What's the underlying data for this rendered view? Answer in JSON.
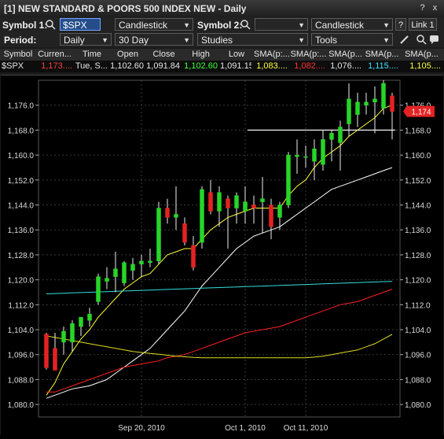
{
  "window": {
    "title": "[1] NEW STANDARD & POORS 500 INDEX NEW - Daily",
    "btn_help": "?",
    "btn_close": "x"
  },
  "toolbar1": {
    "symbol1_label": "Symbol 1:",
    "symbol1_value": "$SPX",
    "chart_type1": "Candlestick",
    "symbol2_label": "Symbol 2:",
    "symbol2_value": "",
    "chart_type2": "Candlestick",
    "help_label": "?",
    "link_label": "Link 1"
  },
  "toolbar2": {
    "period_label": "Period:",
    "period_value": "Daily",
    "range_value": "30 Day",
    "studies_label": "Studies",
    "tools_label": "Tools"
  },
  "quote_table": {
    "headers": [
      "Symbol",
      "Curren...",
      "Time",
      "Open",
      "Close",
      "High",
      "Low",
      "SMA(p:...",
      "SMA(p:...",
      "SMA(p...",
      "SMA(p...",
      "SMA(p..."
    ],
    "row": [
      "$SPX",
      "1,173....",
      "Tue, S...",
      "1,102.60",
      "1,091.84",
      "1,102.60",
      "1,091.15",
      "1,083....",
      "1,082....",
      "1,076....",
      "1,115....",
      "1,105...."
    ],
    "row_colors": [
      "#e6e6e6",
      "#ff4040",
      "#e6e6e6",
      "#e6e6e6",
      "#e6e6e6",
      "#3cff3c",
      "#e6e6e6",
      "#ffff40",
      "#ff3030",
      "#e6e6e6",
      "#40e0ff",
      "#ffff40"
    ]
  },
  "colors": {
    "up": "#27d527",
    "down": "#e52222",
    "sma_yellow": "#ffff33",
    "sma_white": "#ffffff",
    "sma_red": "#ff2020",
    "sma_cyan": "#33dddd",
    "sma_long_yellow": "#dddd22",
    "price_tag": "#e52222"
  },
  "chart_data": {
    "type": "candlestick",
    "ylim": [
      1076,
      1184
    ],
    "yticks": [
      1080,
      1088,
      1096,
      1104,
      1112,
      1120,
      1128,
      1136,
      1144,
      1152,
      1160,
      1168,
      1176
    ],
    "ytick_labels": [
      "1,080.0",
      "1,088.0",
      "1,096.0",
      "1,104.0",
      "1,112.0",
      "1,120.0",
      "1,128.0",
      "1,136.0",
      "1,144.0",
      "1,152.0",
      "1,160.0",
      "1,168.0",
      "1,176.0"
    ],
    "x_labels": [
      {
        "index": 11,
        "label": "Sep 20, 2010"
      },
      {
        "index": 23,
        "label": "Oct 1, 2010"
      },
      {
        "index": 30,
        "label": "Oct 11, 2010"
      }
    ],
    "candles": [
      {
        "o": 1102.6,
        "h": 1103.0,
        "l": 1091.2,
        "c": 1091.8
      },
      {
        "o": 1098.0,
        "h": 1103.0,
        "l": 1091.0,
        "c": 1091.0
      },
      {
        "o": 1100.0,
        "h": 1105.0,
        "l": 1096.0,
        "c": 1103.5
      },
      {
        "o": 1100.0,
        "h": 1107.0,
        "l": 1097.0,
        "c": 1106.0
      },
      {
        "o": 1105.0,
        "h": 1108.0,
        "l": 1102.0,
        "c": 1108.0
      },
      {
        "o": 1107.0,
        "h": 1111.0,
        "l": 1105.0,
        "c": 1109.0
      },
      {
        "o": 1113.0,
        "h": 1122.0,
        "l": 1112.0,
        "c": 1121.0
      },
      {
        "o": 1119.5,
        "h": 1124.0,
        "l": 1117.0,
        "c": 1120.5
      },
      {
        "o": 1121.0,
        "h": 1129.0,
        "l": 1116.0,
        "c": 1123.5
      },
      {
        "o": 1119.0,
        "h": 1126.0,
        "l": 1118.0,
        "c": 1125.5
      },
      {
        "o": 1123.0,
        "h": 1127.0,
        "l": 1120.0,
        "c": 1125.0
      },
      {
        "o": 1125.0,
        "h": 1128.0,
        "l": 1121.0,
        "c": 1126.0
      },
      {
        "o": 1125.5,
        "h": 1130.0,
        "l": 1124.0,
        "c": 1126.0
      },
      {
        "o": 1126.0,
        "h": 1145.0,
        "l": 1125.0,
        "c": 1143.0
      },
      {
        "o": 1143.0,
        "h": 1146.0,
        "l": 1138.0,
        "c": 1140.0
      },
      {
        "o": 1140.0,
        "h": 1150.0,
        "l": 1136.0,
        "c": 1141.0
      },
      {
        "o": 1138.0,
        "h": 1140.0,
        "l": 1131.0,
        "c": 1132.0
      },
      {
        "o": 1131.0,
        "h": 1134.0,
        "l": 1123.0,
        "c": 1124.0
      },
      {
        "o": 1132.0,
        "h": 1150.0,
        "l": 1130.0,
        "c": 1149.0
      },
      {
        "o": 1148.0,
        "h": 1152.0,
        "l": 1141.0,
        "c": 1142.0
      },
      {
        "o": 1142.0,
        "h": 1150.0,
        "l": 1137.0,
        "c": 1148.0
      },
      {
        "o": 1146.0,
        "h": 1147.0,
        "l": 1130.0,
        "c": 1143.0
      },
      {
        "o": 1143.0,
        "h": 1148.0,
        "l": 1138.0,
        "c": 1147.0
      },
      {
        "o": 1142.0,
        "h": 1150.0,
        "l": 1138.0,
        "c": 1145.0
      },
      {
        "o": 1144.0,
        "h": 1147.0,
        "l": 1138.0,
        "c": 1143.0
      },
      {
        "o": 1145.0,
        "h": 1153.0,
        "l": 1135.0,
        "c": 1146.0
      },
      {
        "o": 1144.0,
        "h": 1146.0,
        "l": 1133.0,
        "c": 1137.0
      },
      {
        "o": 1140.0,
        "h": 1145.0,
        "l": 1136.0,
        "c": 1144.0
      },
      {
        "o": 1144.0,
        "h": 1161.0,
        "l": 1143.0,
        "c": 1160.0
      },
      {
        "o": 1159.5,
        "h": 1165.0,
        "l": 1154.0,
        "c": 1160.0
      },
      {
        "o": 1159.5,
        "h": 1163.0,
        "l": 1156.0,
        "c": 1159.5
      },
      {
        "o": 1158.0,
        "h": 1165.0,
        "l": 1152.0,
        "c": 1162.0
      },
      {
        "o": 1157.0,
        "h": 1168.0,
        "l": 1155.0,
        "c": 1165.0
      },
      {
        "o": 1165.0,
        "h": 1168.0,
        "l": 1158.0,
        "c": 1167.0
      },
      {
        "o": 1164.0,
        "h": 1171.0,
        "l": 1155.0,
        "c": 1169.0
      },
      {
        "o": 1170.0,
        "h": 1183.0,
        "l": 1166.0,
        "c": 1178.0
      },
      {
        "o": 1173.0,
        "h": 1180.0,
        "l": 1169.0,
        "c": 1177.0
      },
      {
        "o": 1176.0,
        "h": 1180.0,
        "l": 1173.0,
        "c": 1177.0
      },
      {
        "o": 1177.0,
        "h": 1182.0,
        "l": 1167.0,
        "c": 1178.0
      },
      {
        "o": 1175.0,
        "h": 1184.0,
        "l": 1173.0,
        "c": 1183.0
      },
      {
        "o": 1179.0,
        "h": 1180.0,
        "l": 1165.0,
        "c": 1174.0
      }
    ],
    "sma_series": [
      {
        "color": "#ffff33",
        "values": [
          1083,
          1087,
          1093,
          1097,
          1101,
          1104,
          1108,
          1111,
          1114,
          1117,
          1119,
          1121,
          1122,
          1125,
          1128,
          1129,
          1130,
          1130,
          1133,
          1136,
          1138,
          1140,
          1141,
          1142,
          1143,
          1143,
          1143,
          1143,
          1147,
          1150,
          1152,
          1156,
          1159,
          1161,
          1163,
          1166,
          1168,
          1170,
          1172,
          1175,
          1176
        ]
      },
      {
        "color": "#ffffff",
        "values": [
          1082,
          1083,
          1084,
          1085,
          1085.5,
          1086,
          1087,
          1088,
          1090,
          1092,
          1094,
          1096,
          1098,
          1101,
          1104,
          1107,
          1110,
          1114,
          1118,
          1121,
          1124,
          1127,
          1130,
          1132,
          1134,
          1135,
          1136,
          1137,
          1139,
          1141,
          1143,
          1145,
          1147,
          1149,
          1150,
          1151,
          1152,
          1153,
          1154,
          1155,
          1156
        ]
      },
      {
        "color": "#ff2020",
        "values": [
          1084,
          1084,
          1085,
          1086,
          1087,
          1088,
          1089,
          1090,
          1091,
          1092,
          1092.5,
          1093,
          1093.5,
          1094,
          1095,
          1095.5,
          1096,
          1097,
          1098,
          1099,
          1100,
          1101,
          1102,
          1103,
          1103.5,
          1104,
          1104.5,
          1105,
          1106,
          1107,
          1108,
          1109,
          1110,
          1111,
          1112,
          1112.5,
          1113,
          1114,
          1115,
          1116,
          1117
        ]
      },
      {
        "color": "#33dddd",
        "values": [
          1115.5,
          1115.6,
          1115.7,
          1115.8,
          1115.9,
          1116.0,
          1116.1,
          1116.2,
          1116.3,
          1116.4,
          1116.5,
          1116.6,
          1116.7,
          1116.8,
          1116.9,
          1117.0,
          1117.1,
          1117.2,
          1117.3,
          1117.4,
          1117.5,
          1117.6,
          1117.7,
          1117.8,
          1117.9,
          1118.0,
          1118.1,
          1118.2,
          1118.3,
          1118.4,
          1118.5,
          1118.6,
          1118.7,
          1118.8,
          1118.9,
          1119.0,
          1119.1,
          1119.2,
          1119.3,
          1119.4,
          1119.5
        ]
      },
      {
        "color": "#dddd22",
        "values": [
          1102,
          1101.5,
          1101,
          1100.5,
          1100,
          1099.5,
          1099,
          1098.5,
          1098,
          1097.5,
          1097,
          1096.7,
          1096.4,
          1096.1,
          1095.8,
          1095.5,
          1095.3,
          1095.1,
          1095,
          1095,
          1095,
          1095,
          1095,
          1095,
          1095,
          1095,
          1095,
          1095,
          1095,
          1095,
          1095,
          1095.2,
          1095.5,
          1096,
          1096.5,
          1097,
          1097.5,
          1098.5,
          1099.5,
          1101,
          1102.5
        ]
      }
    ],
    "resistance_line": {
      "from_index": 26,
      "to_index": 40,
      "y": 1168
    },
    "price_tag": {
      "value": 1174,
      "label": "1,174"
    }
  }
}
